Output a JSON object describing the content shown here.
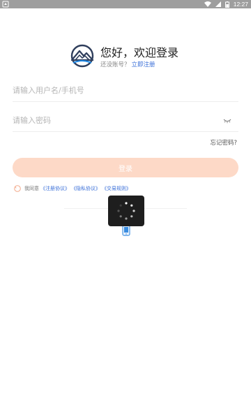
{
  "status_bar": {
    "time": "12:27",
    "icons": [
      "notification-icon",
      "wifi-icon",
      "signal-icon",
      "battery-icon"
    ]
  },
  "header": {
    "logo": "mountain-logo",
    "greeting": "您好，欢迎登录",
    "no_account_text": "还没账号？",
    "register_link": "立即注册"
  },
  "form": {
    "username_placeholder": "请输入用户名/手机号",
    "username_value": "",
    "password_placeholder": "请输入密码",
    "password_value": "",
    "forgot_password": "忘记密码?",
    "login_button": "登录"
  },
  "agreement": {
    "prefix": "我同意",
    "links": [
      "《注册协议》",
      "《隐私协议》",
      "《交易规则》"
    ]
  },
  "alt_login": {
    "icon": "phone-icon"
  },
  "colors": {
    "accent": "#3a6fd8",
    "button_bg": "#fdd9c7",
    "status_bar": "#9e9e9e",
    "logo_dark": "#2f3e5c",
    "logo_light": "#1e88e5"
  }
}
